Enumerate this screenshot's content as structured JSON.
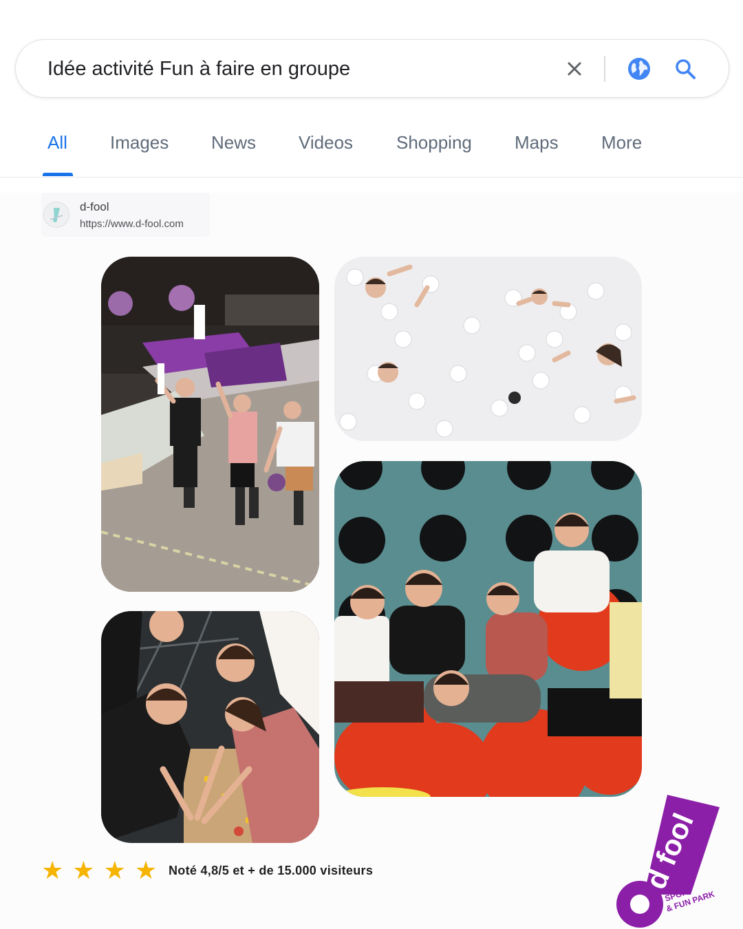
{
  "search": {
    "query": "Idée activité Fun à faire en groupe",
    "clear_icon": "close-icon",
    "globe_icon": "globe-icon",
    "search_icon": "search-icon"
  },
  "tabs": [
    {
      "label": "All",
      "active": true
    },
    {
      "label": "Images",
      "active": false
    },
    {
      "label": "News",
      "active": false
    },
    {
      "label": "Videos",
      "active": false
    },
    {
      "label": "Shopping",
      "active": false
    },
    {
      "label": "Maps",
      "active": false
    },
    {
      "label": "More",
      "active": false
    }
  ],
  "result": {
    "site_name": "d-fool",
    "site_url": "https://www.d-fool.com"
  },
  "rating": {
    "stars": 4,
    "text": "Noté 4,8/5 et + de 15.000 visiteurs"
  },
  "brand": {
    "logo_text": "d fool",
    "tagline_line1": "SPORT",
    "tagline_line2": "& FUN PARK",
    "color": "#8b1fa8"
  },
  "colors": {
    "accent": "#1a73e8",
    "star": "#f5b400"
  }
}
